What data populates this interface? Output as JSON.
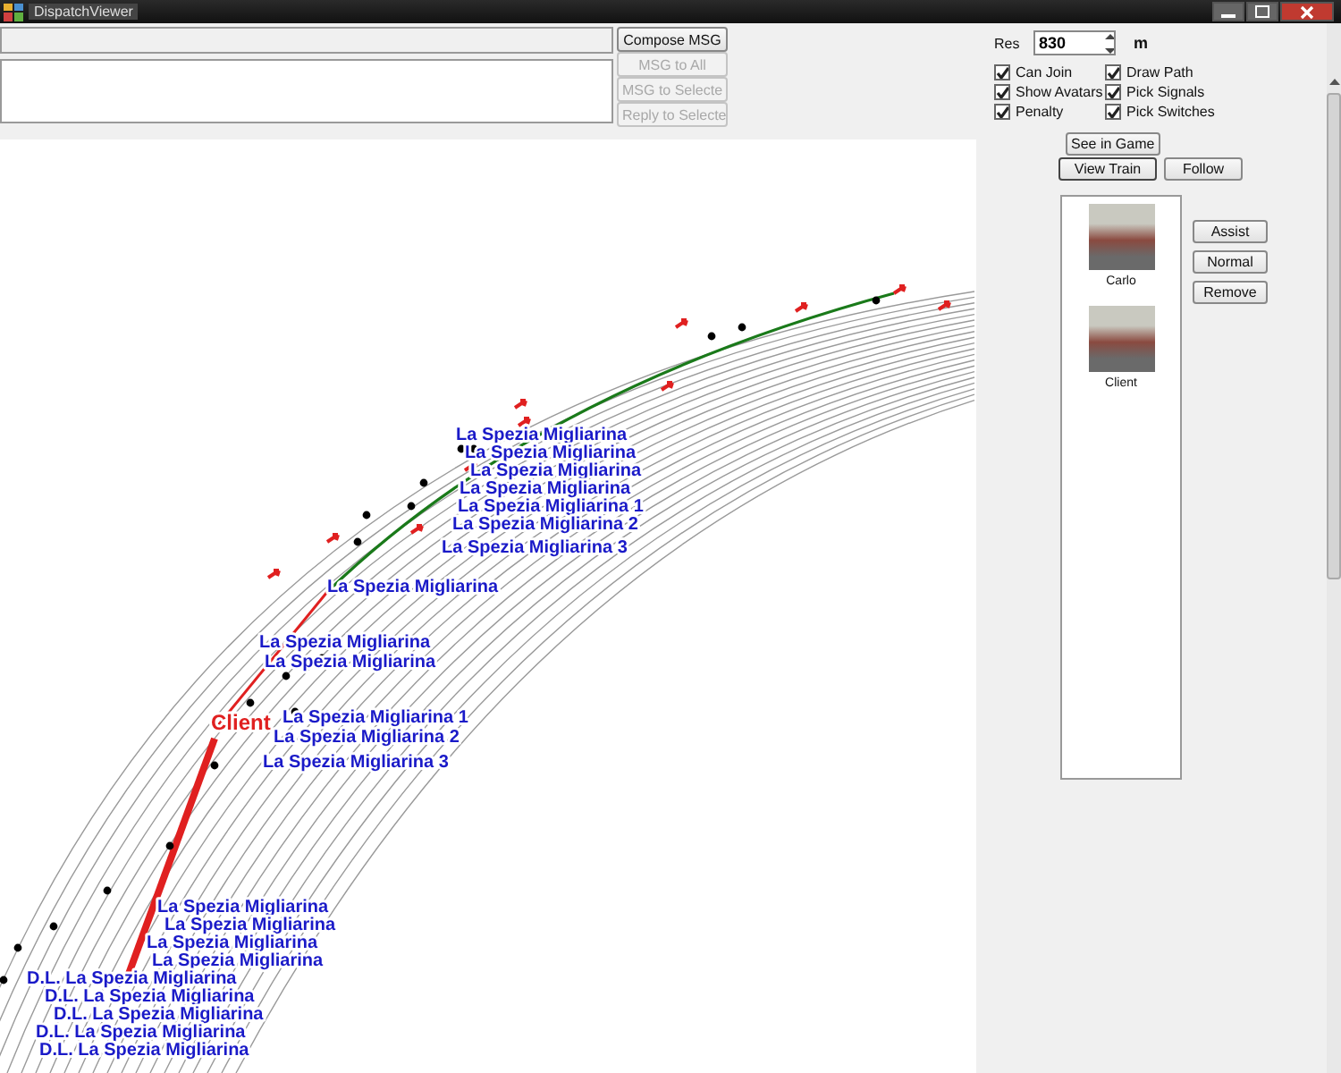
{
  "window": {
    "title": "DispatchViewer"
  },
  "message_buttons": [
    {
      "label": "Compose MSG",
      "disabled": false
    },
    {
      "label": "MSG to All",
      "disabled": true
    },
    {
      "label": "MSG to Selecte",
      "disabled": true
    },
    {
      "label": "Reply to Selecte",
      "disabled": true
    }
  ],
  "resolution": {
    "label": "Res",
    "value": "830",
    "unit": "m"
  },
  "options": [
    {
      "label": "Can Join",
      "checked": true
    },
    {
      "label": "Draw Path",
      "checked": true
    },
    {
      "label": "Show Avatars",
      "checked": true
    },
    {
      "label": "Pick Signals",
      "checked": true
    },
    {
      "label": "Penalty",
      "checked": true
    },
    {
      "label": "Pick Switches",
      "checked": true
    }
  ],
  "view_buttons": [
    {
      "label": "See in Game"
    },
    {
      "label": "View Train"
    },
    {
      "label": "Follow"
    }
  ],
  "players": [
    {
      "name": "Carlo"
    },
    {
      "name": "Client"
    }
  ],
  "player_buttons": [
    {
      "label": "Assist"
    },
    {
      "label": "Normal"
    },
    {
      "label": "Remove"
    }
  ],
  "map_labels": [
    {
      "text": "La Spezia Migliarina",
      "kind": "station"
    },
    {
      "text": "La Spezia Migliarina",
      "kind": "station"
    },
    {
      "text": "La Spezia Migliarina",
      "kind": "station"
    },
    {
      "text": "La Spezia Migliarina",
      "kind": "station"
    },
    {
      "text": "La Spezia Migliarina 1",
      "kind": "station"
    },
    {
      "text": "La Spezia Migliarina 2",
      "kind": "station"
    },
    {
      "text": "La Spezia Migliarina 3",
      "kind": "station"
    },
    {
      "text": "La Spezia Migliarina",
      "kind": "station"
    },
    {
      "text": "La Spezia Migliarina",
      "kind": "station"
    },
    {
      "text": "La Spezia Migliarina",
      "kind": "station"
    },
    {
      "text": "Client",
      "kind": "train"
    },
    {
      "text": "La Spezia Migliarina 1",
      "kind": "station"
    },
    {
      "text": "La Spezia Migliarina 2",
      "kind": "station"
    },
    {
      "text": "La Spezia Migliarina 3",
      "kind": "station"
    },
    {
      "text": "La Spezia Migliarina",
      "kind": "station"
    },
    {
      "text": "La Spezia Migliarina",
      "kind": "station"
    },
    {
      "text": "La Spezia Migliarina",
      "kind": "station"
    },
    {
      "text": "La Spezia Migliarina",
      "kind": "station"
    },
    {
      "text": "D.L. La Spezia Migliarina",
      "kind": "station"
    },
    {
      "text": "D.L. La Spezia Migliarina",
      "kind": "station"
    },
    {
      "text": "D.L. La Spezia Migliarina",
      "kind": "station"
    },
    {
      "text": "D.L. La Spezia Migliarina",
      "kind": "station"
    },
    {
      "text": "D.L. La Spezia Migliarina",
      "kind": "station"
    }
  ]
}
